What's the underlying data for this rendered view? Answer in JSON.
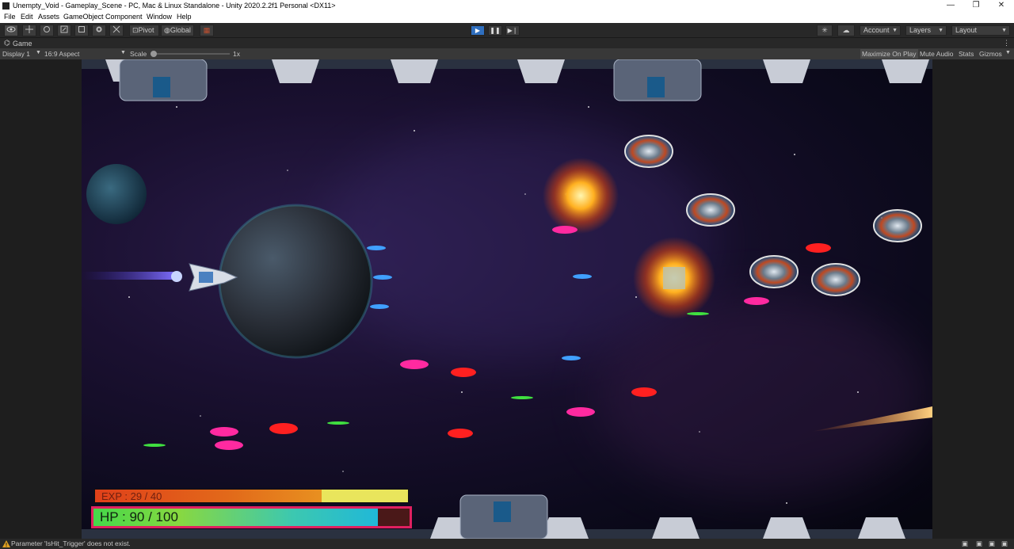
{
  "window": {
    "title": "Unempty_Void - Gameplay_Scene - PC, Mac & Linux Standalone - Unity 2020.2.2f1 Personal <DX11>",
    "controls": {
      "minimize": "—",
      "restore": "❐",
      "close": "✕"
    }
  },
  "menu": [
    "File",
    "Edit",
    "Assets",
    "GameObject",
    "Component",
    "Window",
    "Help"
  ],
  "toolbar": {
    "pivot_label": "Pivot",
    "global_label": "Global",
    "account_label": "Account",
    "layers_label": "Layers",
    "layout_label": "Layout",
    "play_state": "playing"
  },
  "game_tab": {
    "label": "Game",
    "display": "Display 1",
    "aspect": "16:9 Aspect",
    "scale_label": "Scale",
    "scale_value": "1x",
    "scale_level": 0,
    "maximize_label": "Maximize On Play",
    "mute_label": "Mute Audio",
    "stats_label": "Stats",
    "gizmos_label": "Gizmos"
  },
  "hud": {
    "exp_text": "EXP : 29 / 40",
    "exp_current": 29,
    "exp_max": 40,
    "hp_text": "HP : 90 / 100",
    "hp_current": 90,
    "hp_max": 100
  },
  "status": {
    "message": "Parameter 'IsHit_Trigger' does not exist.",
    "level": "warning"
  },
  "colors": {
    "accent": "#2f6fbf",
    "warning": "#e0a020",
    "exp_fill": "#e0401a",
    "exp_empty": "#e9e55c",
    "hp_border": "#e02060"
  }
}
